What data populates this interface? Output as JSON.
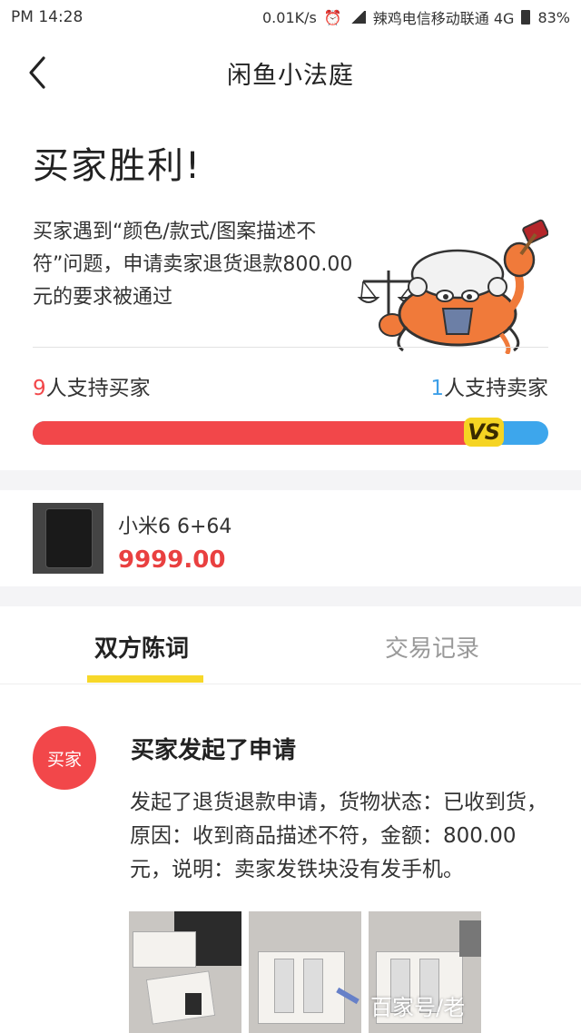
{
  "status_bar": {
    "time": "PM 14:28",
    "speed": "0.01K/s",
    "carrier": "辣鸡电信移动联通 4G",
    "battery": "83%"
  },
  "nav": {
    "title": "闲鱼小法庭"
  },
  "verdict": {
    "title": "买家胜利!",
    "description": "买家遇到“颜色/款式/图案描述不符”问题，申请卖家退货退款800.00元的要求被通过"
  },
  "support": {
    "buyer_count": "9",
    "buyer_label": "人支持买家",
    "seller_count": "1",
    "seller_label": "人支持卖家",
    "buyer_fraction": 0.9,
    "vs_label": "VS"
  },
  "product": {
    "name": "小米6 6+64",
    "price": "9999.00"
  },
  "tabs": [
    {
      "label": "双方陈词",
      "active": true
    },
    {
      "label": "交易记录",
      "active": false
    }
  ],
  "timeline": {
    "avatar_label": "买家",
    "event_title": "买家发起了申请",
    "event_desc": "发起了退货退款申请，货物状态：已收到货，原因：收到商品描述不符，金额：800.00元，说明：卖家发铁块没有发手机。"
  },
  "watermark": "百家号/老",
  "colors": {
    "buyer_red": "#f2474a",
    "seller_blue": "#3da6ec",
    "tab_yellow": "#f7d829",
    "price_red": "#e94040"
  }
}
